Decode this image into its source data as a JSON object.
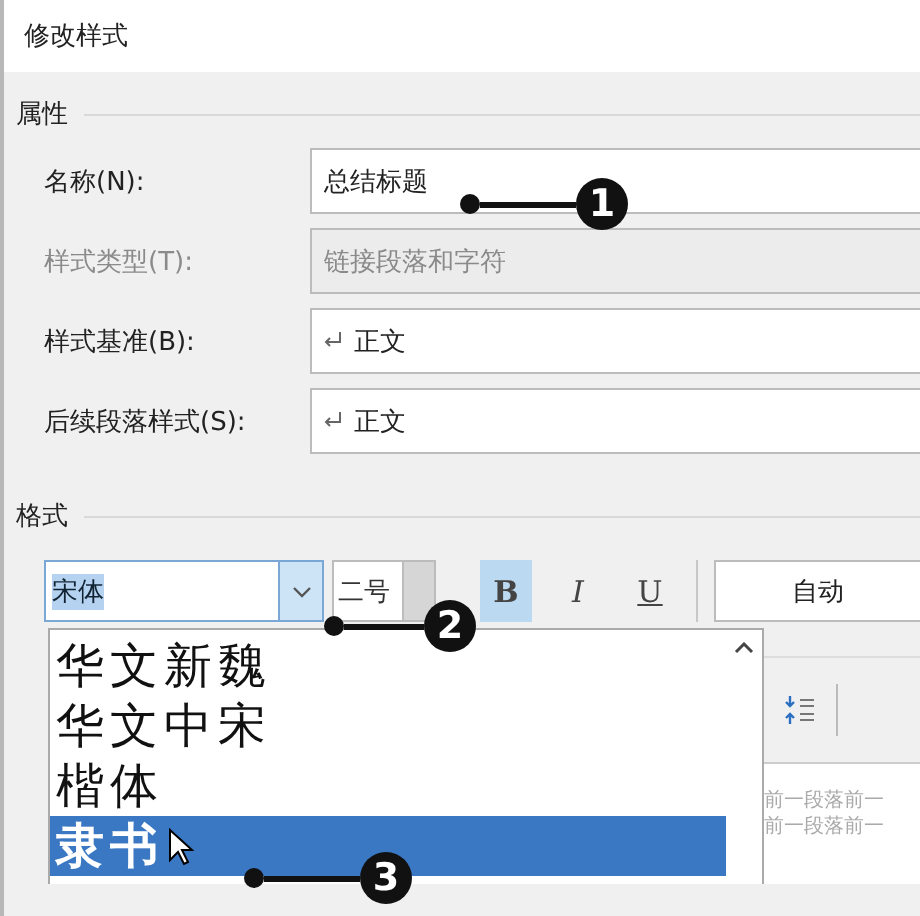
{
  "window": {
    "title": "修改样式"
  },
  "properties": {
    "heading": "属性",
    "rows": [
      {
        "label": "名称(N):",
        "value": "总结标题",
        "disabled": false,
        "kind": "text"
      },
      {
        "label": "样式类型(T):",
        "value": "链接段落和字符",
        "disabled": true,
        "kind": "text"
      },
      {
        "label": "样式基准(B):",
        "value": "正文",
        "disabled": false,
        "kind": "style"
      },
      {
        "label": "后续段落样式(S):",
        "value": "正文",
        "disabled": false,
        "kind": "style"
      }
    ]
  },
  "format": {
    "heading": "格式",
    "font": {
      "value": "宋体",
      "open": true
    },
    "size": {
      "value": "二号"
    },
    "buttons": [
      {
        "label": "B",
        "selected": true,
        "kind": "bold"
      },
      {
        "label": "I",
        "selected": false,
        "kind": "italic"
      },
      {
        "label": "U",
        "selected": false,
        "kind": "underline"
      }
    ],
    "color": {
      "value": "自动"
    },
    "font_list": [
      {
        "label": "华文新魏",
        "selected": false
      },
      {
        "label": "华文中宋",
        "selected": false
      },
      {
        "label": "楷体",
        "selected": false
      },
      {
        "label": "隶书",
        "selected": true
      }
    ],
    "preview": [
      "前一段落前一",
      "前一段落前一"
    ]
  },
  "callouts": [
    {
      "number": "1"
    },
    {
      "number": "2"
    },
    {
      "number": "3"
    }
  ]
}
